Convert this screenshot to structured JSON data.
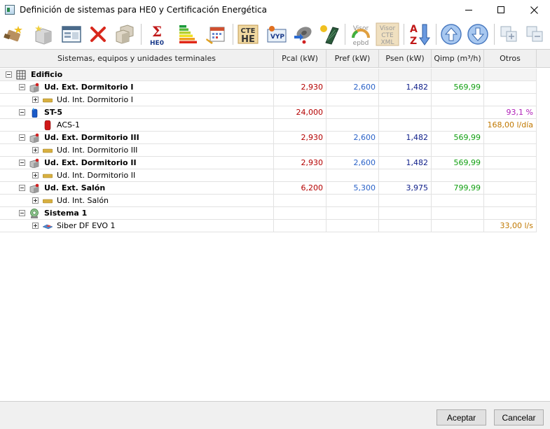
{
  "window": {
    "title": "Definición de sistemas para HE0 y Certificación Energética"
  },
  "toolbar": {
    "sigma_label": "HE0",
    "cte_he_label_1": "CTE",
    "cte_he_label_2": "HE",
    "vyp_label": "VYP",
    "visor_epbd_label_1": "Visor",
    "visor_epbd_label_2": "epbd",
    "visor_xml_label_1": "Visor",
    "visor_xml_label_2": "CTE",
    "visor_xml_label_3": "XML"
  },
  "columns": [
    "Sistemas, equipos y unidades terminales",
    "Pcal (kW)",
    "Pref (kW)",
    "Psen (kW)",
    "Qimp (m³/h)",
    "Otros"
  ],
  "rows": [
    {
      "label": "Edificio",
      "pcal": "",
      "pref": "",
      "psen": "",
      "qimp": "",
      "otros": ""
    },
    {
      "label": "Ud. Ext. Dormitorio I",
      "pcal": "2,930",
      "pref": "2,600",
      "psen": "1,482",
      "qimp": "569,99",
      "otros": ""
    },
    {
      "label": "Ud. Int. Dormitorio I",
      "pcal": "",
      "pref": "",
      "psen": "",
      "qimp": "",
      "otros": ""
    },
    {
      "label": "ST-5",
      "pcal": "24,000",
      "pref": "",
      "psen": "",
      "qimp": "",
      "otros": "93,1 %"
    },
    {
      "label": "ACS-1",
      "pcal": "",
      "pref": "",
      "psen": "",
      "qimp": "",
      "otros": "168,00 l/día"
    },
    {
      "label": "Ud. Ext. Dormitorio III",
      "pcal": "2,930",
      "pref": "2,600",
      "psen": "1,482",
      "qimp": "569,99",
      "otros": ""
    },
    {
      "label": "Ud. Int. Dormitorio III",
      "pcal": "",
      "pref": "",
      "psen": "",
      "qimp": "",
      "otros": ""
    },
    {
      "label": "Ud. Ext. Dormitorio II",
      "pcal": "2,930",
      "pref": "2,600",
      "psen": "1,482",
      "qimp": "569,99",
      "otros": ""
    },
    {
      "label": "Ud. Int. Dormitorio II",
      "pcal": "",
      "pref": "",
      "psen": "",
      "qimp": "",
      "otros": ""
    },
    {
      "label": "Ud. Ext. Salón",
      "pcal": "6,200",
      "pref": "5,300",
      "psen": "3,975",
      "qimp": "799,99",
      "otros": ""
    },
    {
      "label": "Ud. Int. Salón",
      "pcal": "",
      "pref": "",
      "psen": "",
      "qimp": "",
      "otros": ""
    },
    {
      "label": "Sistema 1",
      "pcal": "",
      "pref": "",
      "psen": "",
      "qimp": "",
      "otros": ""
    },
    {
      "label": "Siber DF EVO 1",
      "pcal": "",
      "pref": "",
      "psen": "",
      "qimp": "",
      "otros": "33,00 l/s"
    }
  ],
  "buttons": {
    "ok": "Aceptar",
    "cancel": "Cancelar"
  }
}
